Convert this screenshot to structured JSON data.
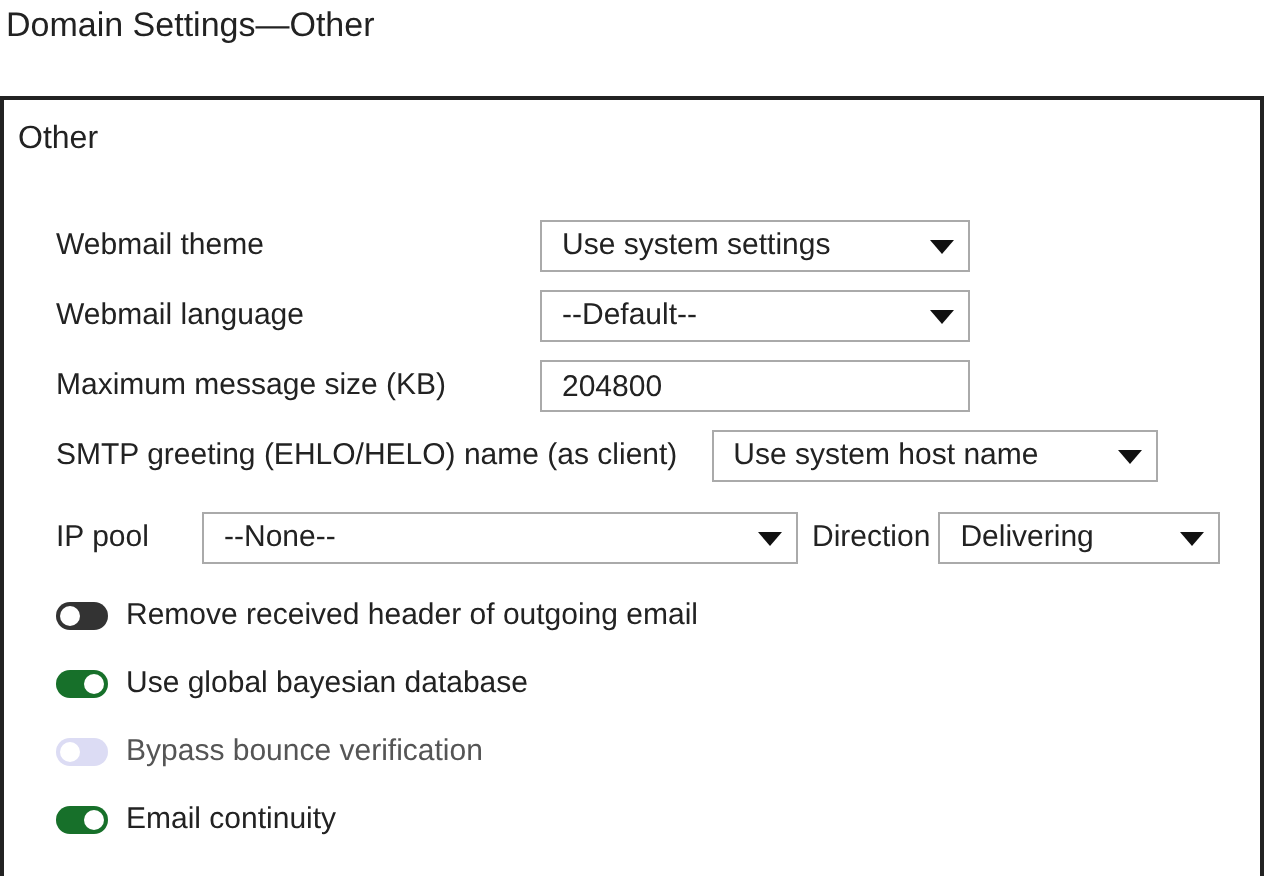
{
  "page_title": "Domain Settings—Other",
  "panel": {
    "title": "Other",
    "fields": [
      {
        "label": "Webmail theme",
        "kind": "select",
        "value": "Use system settings"
      },
      {
        "label": "Webmail language",
        "kind": "select",
        "value": "--Default--"
      },
      {
        "label": "Maximum message size (KB)",
        "kind": "text",
        "value": "204800"
      },
      {
        "label": "SMTP greeting (EHLO/HELO) name (as client)",
        "kind": "select",
        "value": "Use system host name"
      }
    ],
    "ip_row": {
      "ip_label": "IP pool",
      "ip_value": "--None--",
      "direction_label": "Direction",
      "direction_value": "Delivering"
    },
    "toggles": [
      {
        "label": "Remove received header of outgoing email",
        "on": false,
        "disabled": false
      },
      {
        "label": "Use global bayesian database",
        "on": true,
        "disabled": false
      },
      {
        "label": "Bypass bounce verification",
        "on": false,
        "disabled": true
      },
      {
        "label": "Email continuity",
        "on": true,
        "disabled": false
      }
    ]
  }
}
